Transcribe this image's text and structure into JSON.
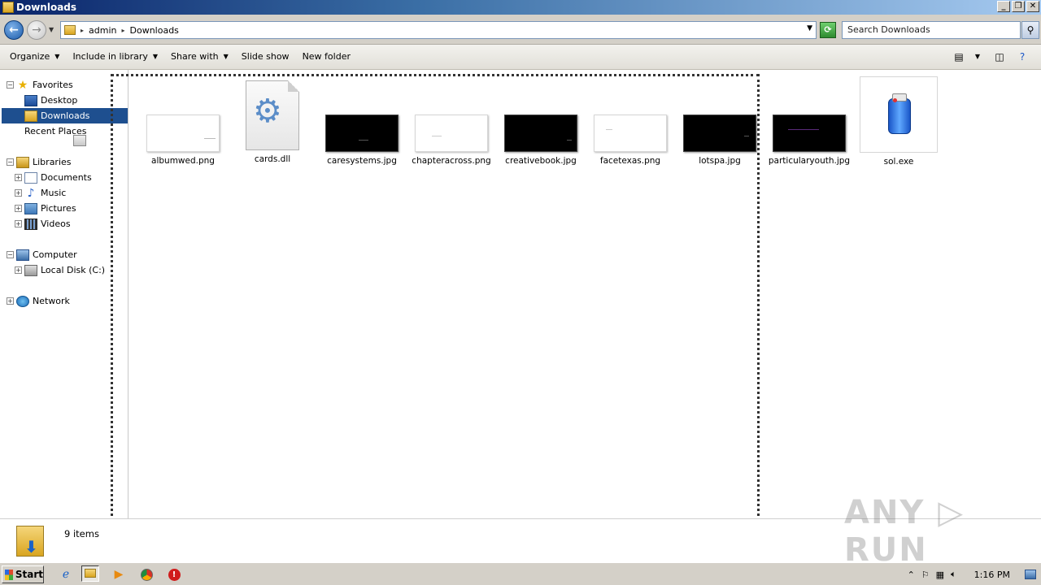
{
  "window": {
    "title": "Downloads"
  },
  "address": {
    "crumbs": [
      "admin",
      "Downloads"
    ],
    "search_placeholder": "Search Downloads"
  },
  "toolbar": {
    "organize": "Organize",
    "include": "Include in library",
    "share": "Share with",
    "slideshow": "Slide show",
    "newfolder": "New folder"
  },
  "nav": {
    "favorites": "Favorites",
    "desktop": "Desktop",
    "downloads": "Downloads",
    "recent": "Recent Places",
    "libraries": "Libraries",
    "documents": "Documents",
    "music": "Music",
    "pictures": "Pictures",
    "videos": "Videos",
    "computer": "Computer",
    "localdisk": "Local Disk (C:)",
    "network": "Network"
  },
  "files": [
    {
      "name": "albumwed.png"
    },
    {
      "name": "cards.dll"
    },
    {
      "name": "caresystems.jpg"
    },
    {
      "name": "chapteracross.png"
    },
    {
      "name": "creativebook.jpg"
    },
    {
      "name": "facetexas.png"
    },
    {
      "name": "lotspa.jpg"
    },
    {
      "name": "particularyouth.jpg"
    },
    {
      "name": "sol.exe"
    }
  ],
  "status": {
    "count": "9 items"
  },
  "watermark": "ANY RUN",
  "taskbar": {
    "start": "Start",
    "clock": "1:16 PM"
  }
}
